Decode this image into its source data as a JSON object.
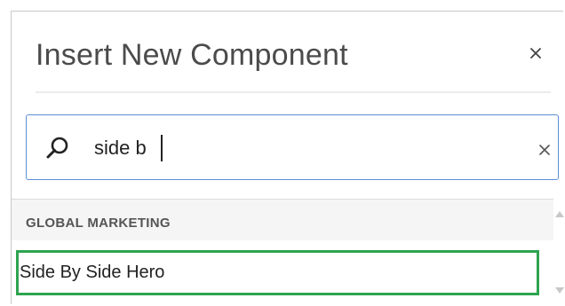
{
  "dialog": {
    "title": "Insert New Component",
    "close_icon": "close-icon"
  },
  "search": {
    "value": "side b",
    "icon": "search-icon",
    "clear_icon": "clear-icon",
    "border_color": "#5a8fd6"
  },
  "results": {
    "group_header": "GLOBAL MARKETING",
    "items": [
      {
        "label": "Side By Side Hero",
        "highlighted": true
      }
    ],
    "highlight_color": "#2ea44f"
  }
}
